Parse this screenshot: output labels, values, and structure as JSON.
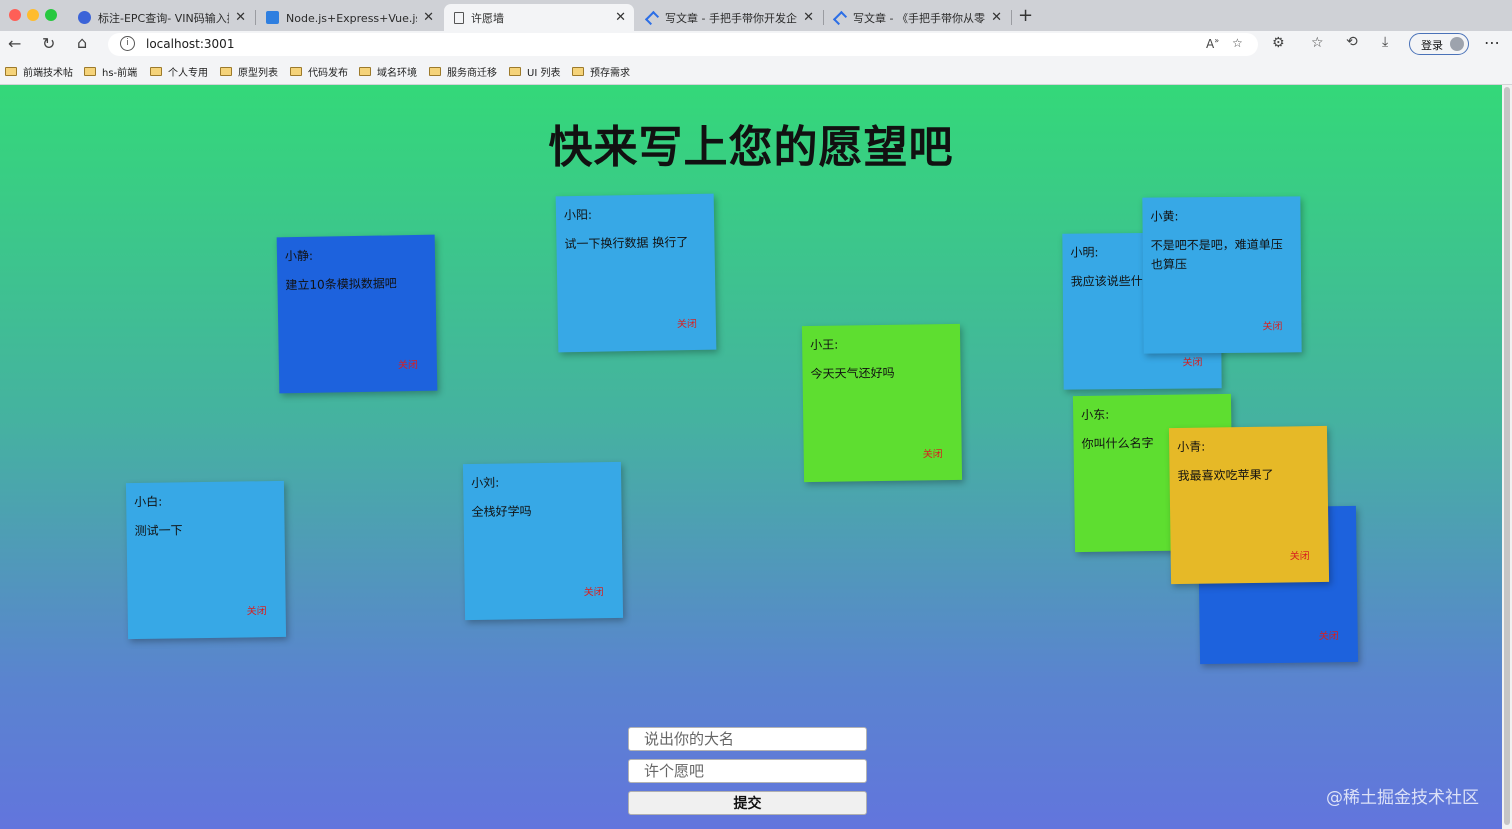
{
  "tabs": [
    {
      "title": "标注-EPC查询- VIN码输入提示",
      "active": false
    },
    {
      "title": "Node.js+Express+Vue.js项目开",
      "active": false
    },
    {
      "title": "许愿墙",
      "active": true
    },
    {
      "title": "写文章 - 手把手带你开发企业级",
      "active": false
    },
    {
      "title": "写文章 - 《手把手带你从零开始",
      "active": false
    }
  ],
  "tab_close_glyph": "✕",
  "new_tab_glyph": "+",
  "address": {
    "url": "localhost:3001"
  },
  "profile": {
    "login_label": "登录"
  },
  "bookmarks": [
    "前端技术帖",
    "hs-前端",
    "个人专用",
    "原型列表",
    "代码发布",
    "域名环境",
    "服务商迁移",
    "UI 列表",
    "预存需求"
  ],
  "page": {
    "title": "快来写上您的愿望吧"
  },
  "notes": [
    {
      "name": "小静:",
      "message": "建立10条模拟数据吧",
      "close": "关闭"
    },
    {
      "name": "小阳:",
      "message": "试一下换行数据 换行了",
      "close": "关闭"
    },
    {
      "name": "小明:",
      "message": "我应该说些什",
      "close": "关闭"
    },
    {
      "name": "小黄:",
      "message": "不是吧不是吧，难道单压也算压",
      "close": "关闭"
    },
    {
      "name": "小王:",
      "message": "今天天气还好吗",
      "close": "关闭"
    },
    {
      "name": "小东:",
      "message": "你叫什么名字",
      "close": "关闭"
    },
    {
      "name": "",
      "message": "",
      "close": "关闭"
    },
    {
      "name": "小青:",
      "message": "我最喜欢吃苹果了",
      "close": "关闭"
    },
    {
      "name": "小白:",
      "message": "测试一下",
      "close": "关闭"
    },
    {
      "name": "小刘:",
      "message": "全栈好学吗",
      "close": "关闭"
    }
  ],
  "form": {
    "name_placeholder": "说出你的大名",
    "wish_placeholder": "许个愿吧",
    "submit_label": "提交"
  },
  "watermark": "@稀土掘金技术社区",
  "colors": {
    "note_blue": "#37a8e6",
    "note_dark_blue": "#1d62dd",
    "note_green": "#5ede30",
    "note_yellow": "#e6b927",
    "close_red": "#d81f1f"
  }
}
